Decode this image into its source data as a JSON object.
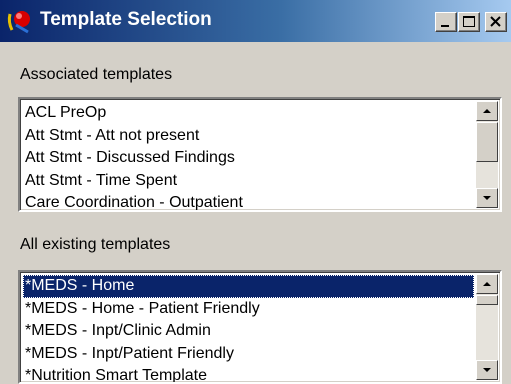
{
  "window": {
    "title": "Template Selection",
    "app_icon": "app-logo-icon",
    "controls": {
      "minimize_icon": "minimize-icon",
      "maximize_icon": "maximize-icon",
      "close_icon": "close-icon"
    }
  },
  "associated": {
    "label": "Associated templates",
    "items": [
      "ACL PreOp",
      "Att Stmt - Att not present",
      "Att Stmt - Discussed Findings",
      "Att Stmt - Time Spent",
      "Care Coordination - Outpatient"
    ]
  },
  "existing": {
    "label": "All existing templates",
    "items": [
      "*MEDS - Home",
      "*MEDS - Home - Patient Friendly",
      "*MEDS - Inpt/Clinic Admin",
      "*MEDS - Inpt/Patient Friendly",
      "*Nutrition Smart Template"
    ],
    "selected_index": 0
  },
  "colors": {
    "title_gradient_start": "#0a246a",
    "selection": "#0a246a",
    "face": "#d4d0c8"
  }
}
